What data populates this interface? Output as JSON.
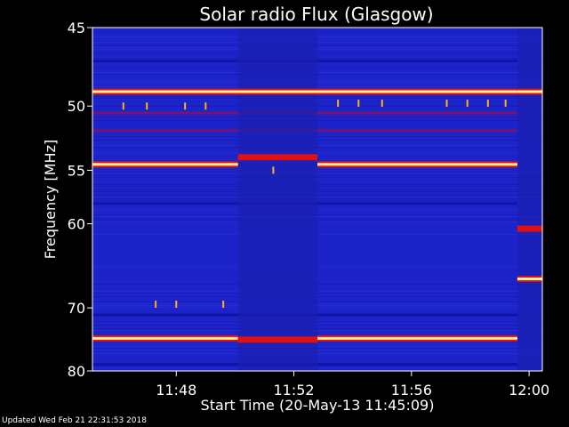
{
  "chart_data": {
    "type": "heatmap",
    "title": "Solar radio Flux (Glasgow)",
    "xlabel": "Start Time (20-May-13 11:45:09)",
    "ylabel": "Frequency [MHz]",
    "x_ticks": [
      "11:48",
      "11:52",
      "11:56",
      "12:00"
    ],
    "x_tick_minutes": [
      48,
      52,
      56,
      60
    ],
    "xlim_minutes": [
      45.15,
      60.45
    ],
    "y_ticks": [
      45,
      50,
      55,
      60,
      70,
      80
    ],
    "ylim": [
      45,
      80
    ],
    "y_scale": "reciprocal",
    "colormap": {
      "background": "#1c23c8",
      "low": "#000064",
      "mid": "#e01010",
      "high": "#fff0a0"
    },
    "gaps_minutes": [
      [
        50.1,
        52.8
      ],
      [
        59.6,
        60.45
      ]
    ],
    "bright_lines": [
      {
        "freq": 49.0,
        "level": "high",
        "t_start": 45.15,
        "t_end": 59.6
      },
      {
        "freq": 54.5,
        "level": "high",
        "t_start": 45.15,
        "t_end": 50.1
      },
      {
        "freq": 54.5,
        "level": "high",
        "t_start": 52.8,
        "t_end": 59.6
      },
      {
        "freq": 74.5,
        "level": "high",
        "t_start": 45.15,
        "t_end": 50.1
      },
      {
        "freq": 74.5,
        "level": "high",
        "t_start": 52.8,
        "t_end": 59.6
      },
      {
        "freq": 74.7,
        "level": "mid",
        "t_start": 50.1,
        "t_end": 52.8
      },
      {
        "freq": 53.9,
        "level": "mid",
        "t_start": 50.1,
        "t_end": 52.8
      },
      {
        "freq": 49.0,
        "level": "high",
        "t_start": 59.6,
        "t_end": 60.45
      },
      {
        "freq": 66.2,
        "level": "high",
        "t_start": 59.6,
        "t_end": 60.45
      },
      {
        "freq": 60.5,
        "level": "mid",
        "t_start": 59.6,
        "t_end": 60.45
      }
    ],
    "dim_lines": [
      {
        "freq": 47.0,
        "level": "low"
      },
      {
        "freq": 50.5,
        "level": "mid"
      },
      {
        "freq": 51.8,
        "level": "mid"
      },
      {
        "freq": 58.0,
        "level": "low"
      },
      {
        "freq": 71.0,
        "level": "low"
      },
      {
        "freq": 78.8,
        "level": "low"
      }
    ],
    "bursts": [
      {
        "t": 47.3,
        "freq": 69.5
      },
      {
        "t": 48.0,
        "freq": 69.5
      },
      {
        "t": 49.6,
        "freq": 69.5
      },
      {
        "t": 46.2,
        "freq": 50.0
      },
      {
        "t": 47.0,
        "freq": 50.0
      },
      {
        "t": 48.3,
        "freq": 50.0
      },
      {
        "t": 49.0,
        "freq": 50.0
      },
      {
        "t": 53.5,
        "freq": 49.8
      },
      {
        "t": 54.2,
        "freq": 49.8
      },
      {
        "t": 55.0,
        "freq": 49.8
      },
      {
        "t": 57.2,
        "freq": 49.8
      },
      {
        "t": 57.9,
        "freq": 49.8
      },
      {
        "t": 58.6,
        "freq": 49.8
      },
      {
        "t": 59.2,
        "freq": 49.8
      },
      {
        "t": 51.3,
        "freq": 55.0
      }
    ]
  },
  "footer": {
    "updated": "Updated Wed Feb 21 22:31:53 2018"
  }
}
